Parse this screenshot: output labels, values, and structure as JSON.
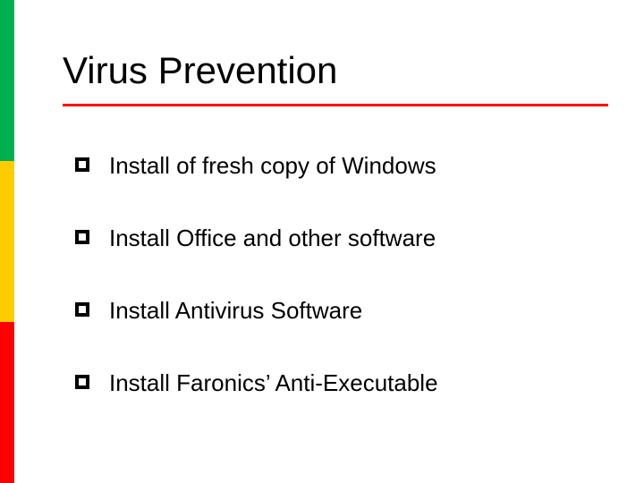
{
  "title": "Virus Prevention",
  "colors": {
    "stripe_green": "#00b050",
    "stripe_yellow": "#ffcc00",
    "stripe_red": "#ff0000",
    "rule": "#ff0000"
  },
  "bullets": [
    "Install of fresh copy of Windows",
    "Install Office and other software",
    "Install Antivirus Software",
    "Install Faronics’ Anti-Executable"
  ]
}
